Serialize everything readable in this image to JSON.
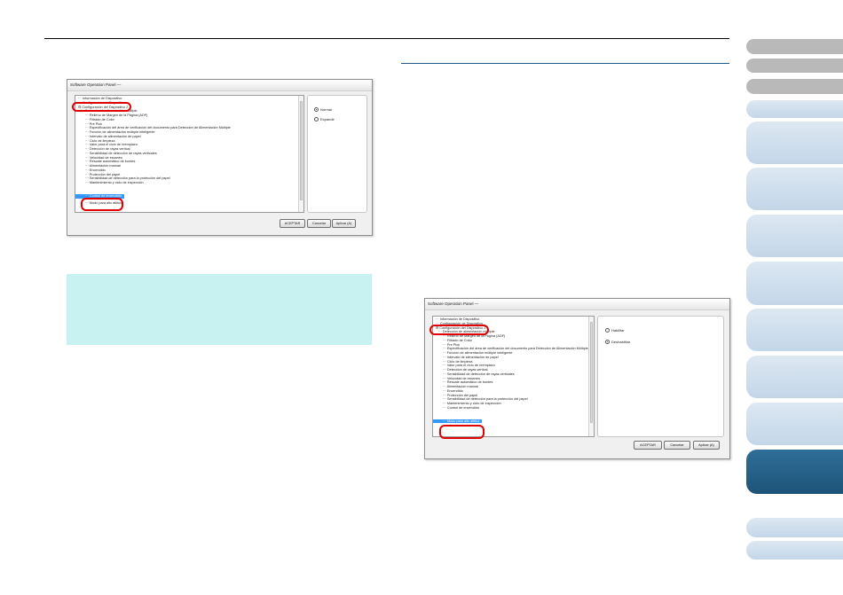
{
  "dialog1": {
    "title": "Software Operation Panel ―",
    "tree": [
      {
        "label": "Información de Dispositivo",
        "level": 0
      },
      {
        "label": "Configuración de Dispositivo",
        "level": 0
      },
      {
        "label": "Configuración del Dispositivo 2",
        "level": 0
      },
      {
        "label": "Detección de alimentación múltiple",
        "level": 1
      },
      {
        "label": "Relleno de Margen de la Página (ADF)",
        "level": 2
      },
      {
        "label": "Filtrado de Color",
        "level": 2
      },
      {
        "label": "Pre Pick",
        "level": 2
      },
      {
        "label": "Especificación del área de verificación del documento para Detección de Alimentación Múltiple",
        "level": 2
      },
      {
        "label": "Función de alimentación múltiple inteligente",
        "level": 2
      },
      {
        "label": "Intervalo de alimentación de papel",
        "level": 2
      },
      {
        "label": "Ciclo de limpieza",
        "level": 2
      },
      {
        "label": "Valor para el ciclo de reemplazo",
        "level": 2
      },
      {
        "label": "Detección de rayas vertical",
        "level": 2
      },
      {
        "label": "Sensibilidad de detección de rayas verticales",
        "level": 2
      },
      {
        "label": "Velocidad de escaneo",
        "level": 2
      },
      {
        "label": "Rescate automático de bordes",
        "level": 2
      },
      {
        "label": "Alimentación manual",
        "level": 2
      },
      {
        "label": "Encendido",
        "level": 2
      },
      {
        "label": "Protección del papel",
        "level": 2
      },
      {
        "label": "Sensibilidad de detección para la protección del papel",
        "level": 2
      },
      {
        "label": "Mantenimiento y ciclo de inspección",
        "level": 2
      },
      {
        "label": "Control de encendido",
        "level": 2,
        "selected": true
      },
      {
        "label": "Modo para alto altitud",
        "level": 2
      }
    ],
    "options": [
      {
        "label": "Normal",
        "checked": true
      },
      {
        "label": "Expandir",
        "checked": false
      }
    ],
    "buttons": {
      "ok": "ACEPTAR",
      "cancel": "Cancelar",
      "apply": "Aplicar (A)"
    }
  },
  "dialog2": {
    "title": "Software Operation Panel ―",
    "tree": [
      {
        "label": "Información de Dispositivo",
        "level": 0
      },
      {
        "label": "Configuración de Dispositivo",
        "level": 0
      },
      {
        "label": "Configuración del Dispositivo 2",
        "level": 0
      },
      {
        "label": "Detección de alimentación múltiple",
        "level": 1
      },
      {
        "label": "Relleno de Margen de la Página (ADF)",
        "level": 2
      },
      {
        "label": "Filtrado de Color",
        "level": 2
      },
      {
        "label": "Pre Pick",
        "level": 2
      },
      {
        "label": "Especificación del área de verificación del documento para Detección de Alimentación Múltiple",
        "level": 2
      },
      {
        "label": "Función de alimentación múltiple inteligente",
        "level": 2
      },
      {
        "label": "Intervalo de alimentación de papel",
        "level": 2
      },
      {
        "label": "Ciclo de limpieza",
        "level": 2
      },
      {
        "label": "Valor para el ciclo de reemplazo",
        "level": 2
      },
      {
        "label": "Detección de rayas vertical",
        "level": 2
      },
      {
        "label": "Sensibilidad de detección de rayas verticales",
        "level": 2
      },
      {
        "label": "Velocidad de escaneo",
        "level": 2
      },
      {
        "label": "Rescate automático de bordes",
        "level": 2
      },
      {
        "label": "Alimentación manual",
        "level": 2
      },
      {
        "label": "Encendido",
        "level": 2
      },
      {
        "label": "Protección del papel",
        "level": 2
      },
      {
        "label": "Sensibilidad de detección para la protección del papel",
        "level": 2
      },
      {
        "label": "Mantenimiento y ciclo de inspección",
        "level": 2
      },
      {
        "label": "Control de encendido",
        "level": 2
      },
      {
        "label": "Modo para alto altitud",
        "level": 2,
        "selected": true
      }
    ],
    "options": [
      {
        "label": "Habilitar",
        "checked": false
      },
      {
        "label": "Deshabilitar",
        "checked": true
      }
    ],
    "buttons": {
      "ok": "ACEPTAR",
      "cancel": "Cancelar",
      "apply": "Aplicar (A)"
    }
  },
  "side_tabs": [
    {
      "style": "gray"
    },
    {
      "style": "gray"
    },
    {
      "style": "gray"
    },
    {
      "style": "light"
    },
    {
      "style": "light"
    },
    {
      "style": "light"
    },
    {
      "style": "light"
    },
    {
      "style": "light"
    },
    {
      "style": "light"
    },
    {
      "style": "light"
    },
    {
      "style": "light"
    },
    {
      "style": "active"
    },
    {
      "style": "light"
    },
    {
      "style": "light"
    }
  ]
}
